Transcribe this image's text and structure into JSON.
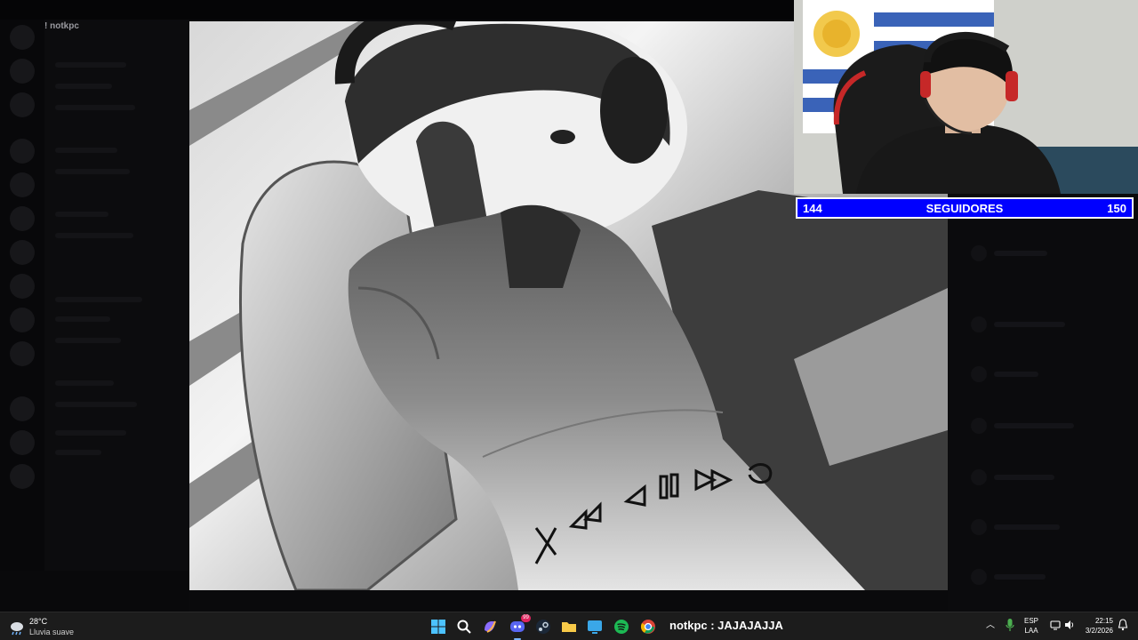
{
  "background_app": {
    "window_title": "",
    "server_name": "! notkpc",
    "server_subtitle": ""
  },
  "goal_bar": {
    "current": "144",
    "label": "SEGUIDORES",
    "target": "150",
    "color": "#0000ff"
  },
  "taskbar": {
    "weather": {
      "temperature": "28°C",
      "description": "Lluvia suave",
      "icon": "cloud-rain-icon"
    },
    "apps": [
      {
        "name": "start-button",
        "icon": "windows-icon"
      },
      {
        "name": "search-button",
        "icon": "search-icon"
      },
      {
        "name": "copilot-button",
        "icon": "copilot-icon"
      },
      {
        "name": "discord-button",
        "icon": "discord-icon",
        "badge": "99"
      },
      {
        "name": "steam-button",
        "icon": "steam-icon"
      },
      {
        "name": "file-explorer-button",
        "icon": "folder-icon"
      },
      {
        "name": "app-button",
        "icon": "window-icon"
      },
      {
        "name": "spotify-button",
        "icon": "spotify-icon"
      },
      {
        "name": "chrome-button",
        "icon": "chrome-icon"
      }
    ],
    "chat_message": "notkpc : JAJAJAJJA",
    "tray": {
      "language_top": "ESP",
      "language_bottom": "LAA",
      "time": "22:15",
      "date": "3/2/2026"
    }
  }
}
